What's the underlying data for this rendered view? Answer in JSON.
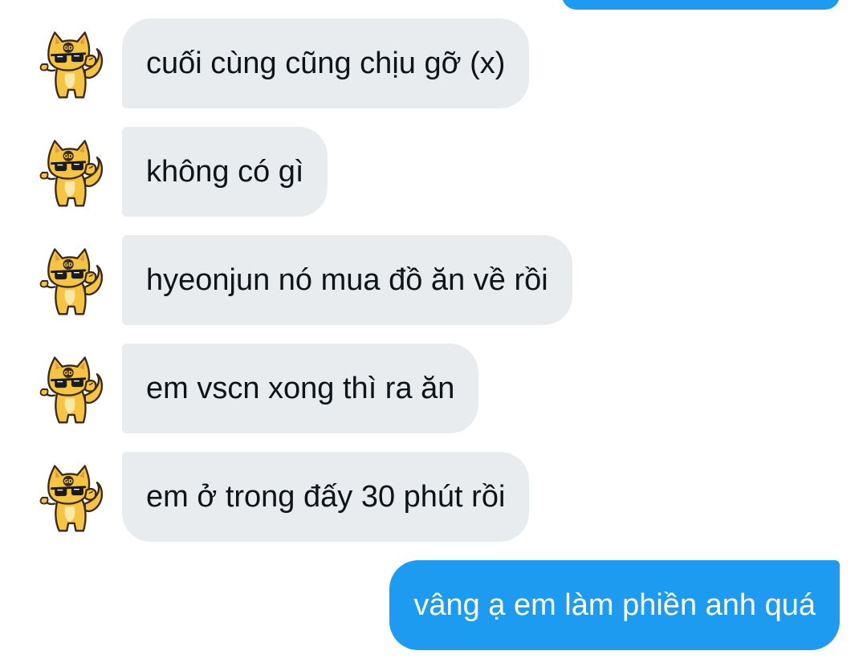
{
  "colors": {
    "received_bubble": "#e8ecef",
    "sent_bubble": "#1d9bf0",
    "received_text": "#0f1419",
    "sent_text": "#ffffff",
    "avatar_fur": "#f5c542"
  },
  "avatar": {
    "icon": "cat-with-sunglasses-sticker-icon"
  },
  "messages": [
    {
      "text": "cuối cùng cũng chịu gỡ (x)"
    },
    {
      "text": "không có gì"
    },
    {
      "text": "hyeonjun nó mua đồ ăn về rồi"
    },
    {
      "text": "em vscn xong thì ra ăn"
    },
    {
      "text": "em ở trong đấy 30 phút rồi"
    }
  ],
  "sent_message": {
    "text": "vâng ạ em làm phiền anh quá"
  }
}
